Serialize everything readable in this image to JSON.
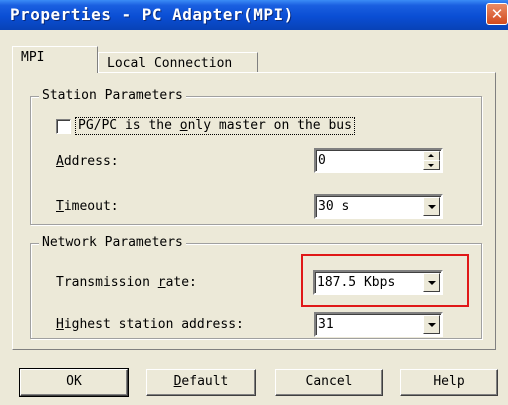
{
  "window": {
    "title": "Properties - PC Adapter(MPI)",
    "close_glyph": "✕"
  },
  "tabs": [
    {
      "label": "MPI",
      "active": true
    },
    {
      "label": "Local Connection",
      "active": false
    }
  ],
  "station_parameters": {
    "legend": "Station Parameters",
    "only_master": {
      "label_prefix": "PG/PC is the ",
      "label_accel": "o",
      "label_suffix": "nly master on the bus",
      "checked": false
    },
    "address": {
      "label_accel": "A",
      "label_rest": "ddress:",
      "value": "0"
    },
    "timeout": {
      "label_accel": "T",
      "label_rest": "imeout:",
      "value": "30 s"
    }
  },
  "network_parameters": {
    "legend": "Network Parameters",
    "transmission_rate": {
      "label_prefix": "Transmission ",
      "label_accel": "r",
      "label_suffix": "ate:",
      "value": "187.5 Kbps"
    },
    "highest_address": {
      "label_accel": "H",
      "label_rest": "ighest station address:",
      "value": "31"
    }
  },
  "buttons": {
    "ok": "OK",
    "default_accel": "D",
    "default_rest": "efault",
    "cancel": "Cancel",
    "help": "Help"
  },
  "colors": {
    "title_bar": "#0a4ed4",
    "dialog_bg": "#ece9d8",
    "highlight_box": "#e01818"
  }
}
